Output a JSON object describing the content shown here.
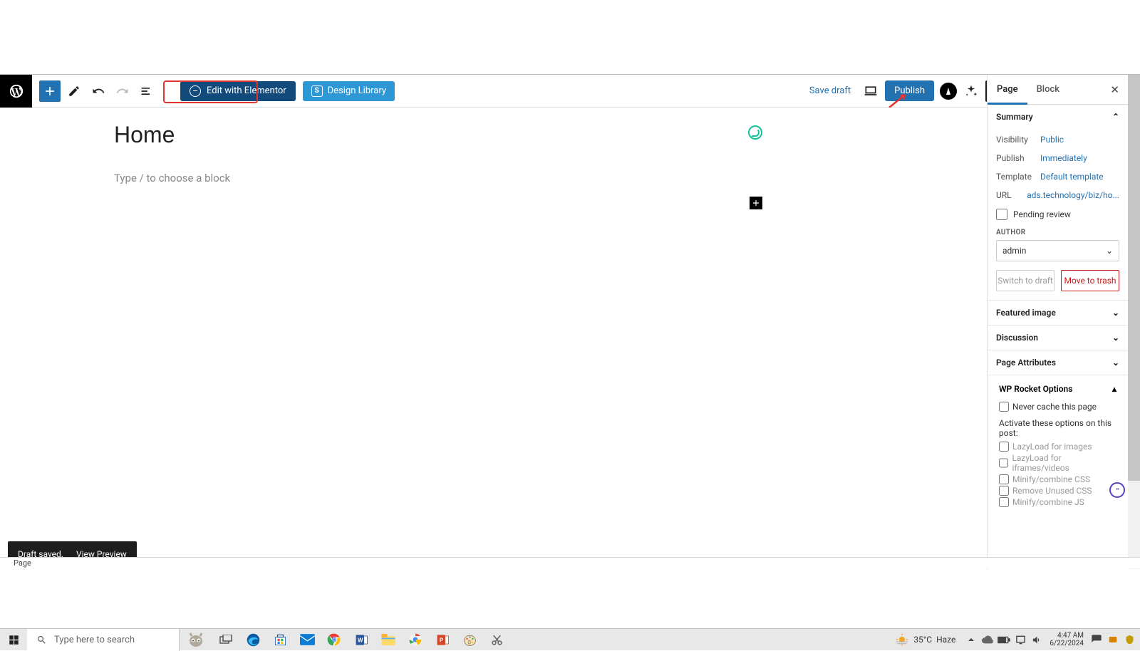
{
  "toolbar": {
    "edit_elementor_label": "Edit with Elementor",
    "design_library_label": "Design Library",
    "save_draft_label": "Save draft",
    "publish_label": "Publish"
  },
  "editor": {
    "title_value": "Home",
    "block_placeholder": "Type / to choose a block"
  },
  "sidebar": {
    "tabs": {
      "page": "Page",
      "block": "Block"
    },
    "summary_label": "Summary",
    "visibility": {
      "label": "Visibility",
      "value": "Public"
    },
    "publish": {
      "label": "Publish",
      "value": "Immediately"
    },
    "template": {
      "label": "Template",
      "value": "Default template"
    },
    "url": {
      "label": "URL",
      "value": "ads.technology/biz/ho..."
    },
    "pending_review_label": "Pending review",
    "author_label": "AUTHOR",
    "author_value": "admin",
    "switch_draft_label": "Switch to draft",
    "move_trash_label": "Move to trash",
    "featured_image_label": "Featured image",
    "discussion_label": "Discussion",
    "page_attributes_label": "Page Attributes",
    "rocket": {
      "title": "WP Rocket Options",
      "never_cache": "Never cache this page",
      "activate_text": "Activate these options on this post:",
      "opts": [
        "LazyLoad for images",
        "LazyLoad for iframes/videos",
        "Minify/combine CSS",
        "Remove Unused CSS",
        "Minify/combine JS"
      ]
    }
  },
  "toast": {
    "saved": "Draft saved.",
    "preview": "View Preview"
  },
  "statusbar": {
    "text": "Page"
  },
  "taskbar": {
    "search_placeholder": "Type here to search",
    "weather_temp": "35°C",
    "weather_cond": "Haze",
    "time": "4:47 AM",
    "date": "6/22/2024"
  }
}
